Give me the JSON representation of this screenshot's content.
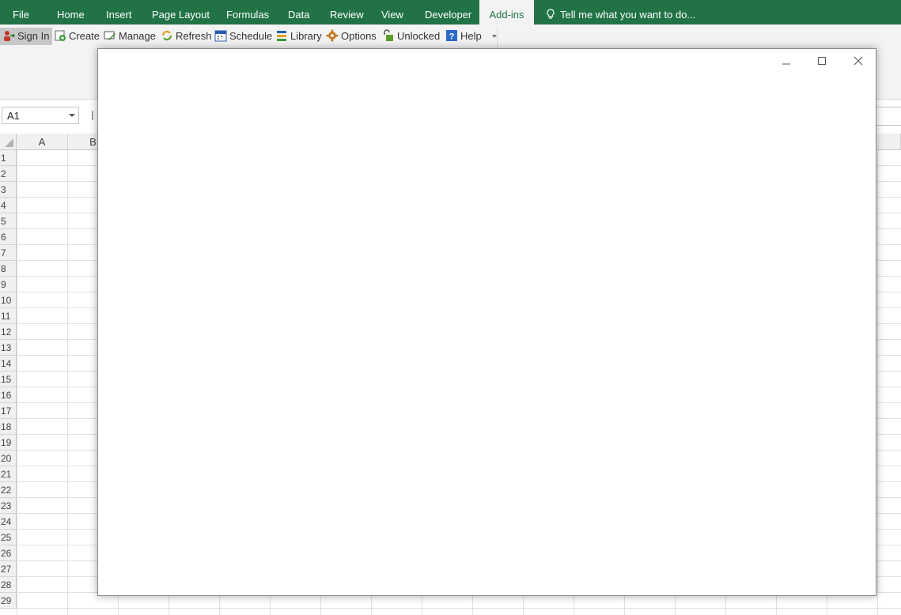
{
  "ribbon_tabs": [
    {
      "label": "File"
    },
    {
      "label": "Home"
    },
    {
      "label": "Insert"
    },
    {
      "label": "Page Layout"
    },
    {
      "label": "Formulas"
    },
    {
      "label": "Data"
    },
    {
      "label": "Review"
    },
    {
      "label": "View"
    },
    {
      "label": "Developer"
    },
    {
      "label": "Add-ins",
      "active": true
    }
  ],
  "tell_me": "Tell me what you want to do...",
  "addin_buttons": [
    {
      "label": "Sign In",
      "icon": "sign-in-icon",
      "selected": true
    },
    {
      "label": "Create",
      "icon": "create-icon"
    },
    {
      "label": "Manage",
      "icon": "manage-icon"
    },
    {
      "label": "Refresh",
      "icon": "refresh-icon"
    },
    {
      "label": "Schedule",
      "icon": "schedule-icon"
    },
    {
      "label": "Library",
      "icon": "library-icon"
    },
    {
      "label": "Options",
      "icon": "gear-icon"
    },
    {
      "label": "Unlocked",
      "icon": "unlocked-icon"
    },
    {
      "label": "Help",
      "icon": "help-icon"
    }
  ],
  "name_box": "A1",
  "columns": [
    "A",
    "B"
  ],
  "rows": [
    "1",
    "2",
    "3",
    "4",
    "5",
    "6",
    "7",
    "8",
    "9",
    "10",
    "11",
    "12",
    "13",
    "14",
    "15",
    "16",
    "17",
    "18",
    "19",
    "20",
    "21",
    "22",
    "23",
    "24",
    "25",
    "26",
    "27",
    "28",
    "29"
  ],
  "colors": {
    "excel_green": "#217346",
    "ribbon_bg": "#f3f3f3"
  }
}
